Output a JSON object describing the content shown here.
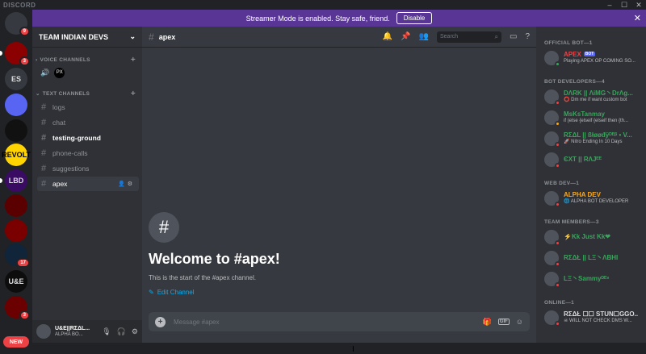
{
  "app": {
    "brand": "DISCORD"
  },
  "banner": {
    "text": "Streamer Mode is enabled. Stay safe, friend.",
    "button": "Disable"
  },
  "rail": {
    "servers": [
      {
        "label": "",
        "badge": "9",
        "color": "#36393f"
      },
      {
        "label": "",
        "badge": "3",
        "color": "#8b0000"
      },
      {
        "label": "ES",
        "badge": "",
        "color": "#36393f"
      },
      {
        "label": "",
        "badge": "",
        "color": "#5865f2"
      },
      {
        "label": "",
        "badge": "",
        "color": "#111111"
      },
      {
        "label": "REVOLT",
        "badge": "",
        "color": "#ffd400"
      },
      {
        "label": "LBD",
        "badge": "",
        "color": "#3a0b63"
      },
      {
        "label": "",
        "badge": "",
        "color": "#5a0000"
      },
      {
        "label": "",
        "badge": "",
        "color": "#7a0000"
      },
      {
        "label": "",
        "badge": "17",
        "color": "#10243a"
      },
      {
        "label": "U&E",
        "badge": "",
        "color": "#0d0d0d"
      },
      {
        "label": "",
        "badge": "3",
        "color": "#6a0000"
      }
    ],
    "new_label": "NEW"
  },
  "sidebar": {
    "guild_name": "TEAM INDIAN DEVS",
    "voice_category": "VOICE CHANNELS",
    "voice_user_label": "PX",
    "text_category": "TEXT CHANNELS",
    "channels": [
      {
        "name": "logs"
      },
      {
        "name": "chat"
      },
      {
        "name": "testing-ground"
      },
      {
        "name": "phone-calls"
      },
      {
        "name": "suggestions"
      },
      {
        "name": "apex"
      }
    ]
  },
  "user": {
    "name": "U&E||RΣΔL...",
    "status": "ALPHA BO..."
  },
  "channel_header": {
    "name": "apex",
    "search_placeholder": "Search"
  },
  "welcome": {
    "title": "Welcome to #apex!",
    "subtitle": "This is the start of the #apex channel.",
    "edit_label": "Edit Channel"
  },
  "composer": {
    "placeholder": "Message #apex",
    "gif_label": "GIF"
  },
  "members": {
    "groups": [
      {
        "title": "OFFICIAL BOT—1",
        "items": [
          {
            "name": "APEX",
            "status": "Playing APEX OP COMING SO...",
            "color": "#ed4245",
            "bot": "BOT"
          }
        ]
      },
      {
        "title": "BOT DEVELOPERS—4",
        "items": [
          {
            "name": "DΛRK || ΛiMG丶DrΛg...",
            "status": "⭕ Dm me if want custom bot",
            "color": "#3ba55d",
            "bot": ""
          },
          {
            "name": "MsKsTanmay",
            "status": "if (else {elseif {elseif then {th...",
            "color": "#3ba55d",
            "bot": ""
          },
          {
            "name": "RΣΔL || ßłøøđÿᴰᴱᵝ • V...",
            "status": "🚀 Nitro Ending In 10 Days",
            "color": "#3ba55d",
            "bot": ""
          },
          {
            "name": "ЄXT || RΛJᴱᴱ",
            "status": "",
            "color": "#3ba55d",
            "bot": ""
          }
        ]
      },
      {
        "title": "WEB DEV—1",
        "items": [
          {
            "name": "ALPHA DEV",
            "status": "🌐 ALPHA BOT DEVELOPER",
            "color": "#faa81a",
            "bot": ""
          }
        ]
      },
      {
        "title": "TEAM MEMBERS—3",
        "items": [
          {
            "name": "⚡Kk Just Kk❤",
            "status": "",
            "color": "#3ba55d",
            "bot": ""
          },
          {
            "name": "RΣΔŁ || LΞ丶ΛBHI",
            "status": "",
            "color": "#3ba55d",
            "bot": ""
          },
          {
            "name": "LΞ丶Sammyᴰᴱᵛ",
            "status": "",
            "color": "#3ba55d",
            "bot": ""
          }
        ]
      },
      {
        "title": "ONLINE—1",
        "items": [
          {
            "name": "RΣΔŁ ☐☐ STUN☐GGO...",
            "status": "☠ WILL NOT CHECK DMS W...",
            "color": "#dcddde",
            "bot": ""
          }
        ]
      }
    ]
  }
}
